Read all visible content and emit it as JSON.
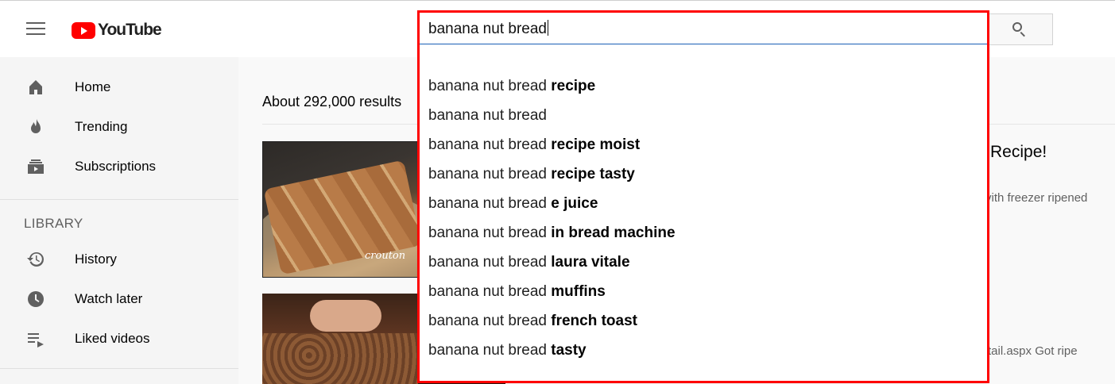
{
  "header": {
    "logo_text": "YouTube",
    "search_value": "banana nut bread"
  },
  "sidebar": {
    "items": [
      {
        "label": "Home",
        "icon": "home-icon"
      },
      {
        "label": "Trending",
        "icon": "trending-icon"
      },
      {
        "label": "Subscriptions",
        "icon": "subscriptions-icon"
      }
    ],
    "library_title": "LIBRARY",
    "library_items": [
      {
        "label": "History",
        "icon": "history-icon"
      },
      {
        "label": "Watch later",
        "icon": "watch-later-icon"
      },
      {
        "label": "Liked videos",
        "icon": "liked-videos-icon"
      }
    ]
  },
  "results": {
    "count_text": "About 292,000 results",
    "thumb1_watermark": "crouton",
    "title_fragment": "Recipe!",
    "desc_fragment_1": "vith freezer ripened",
    "desc_fragment_2": "tail.aspx Got ripe"
  },
  "suggestions": [
    {
      "prefix": "banana nut bread ",
      "bold": "recipe"
    },
    {
      "prefix": "banana nut bread",
      "bold": ""
    },
    {
      "prefix": "banana nut bread ",
      "bold": "recipe moist"
    },
    {
      "prefix": "banana nut bread ",
      "bold": "recipe tasty"
    },
    {
      "prefix": "banana nut bread ",
      "bold": "e juice"
    },
    {
      "prefix": "banana nut bread ",
      "bold": "in bread machine"
    },
    {
      "prefix": "banana nut bread ",
      "bold": "laura vitale"
    },
    {
      "prefix": "banana nut bread ",
      "bold": "muffins"
    },
    {
      "prefix": "banana nut bread ",
      "bold": "french toast"
    },
    {
      "prefix": "banana nut bread ",
      "bold": "tasty"
    }
  ],
  "colors": {
    "brand_red": "#ff0000",
    "highlight": "#ff0000",
    "text_secondary": "#606060"
  }
}
